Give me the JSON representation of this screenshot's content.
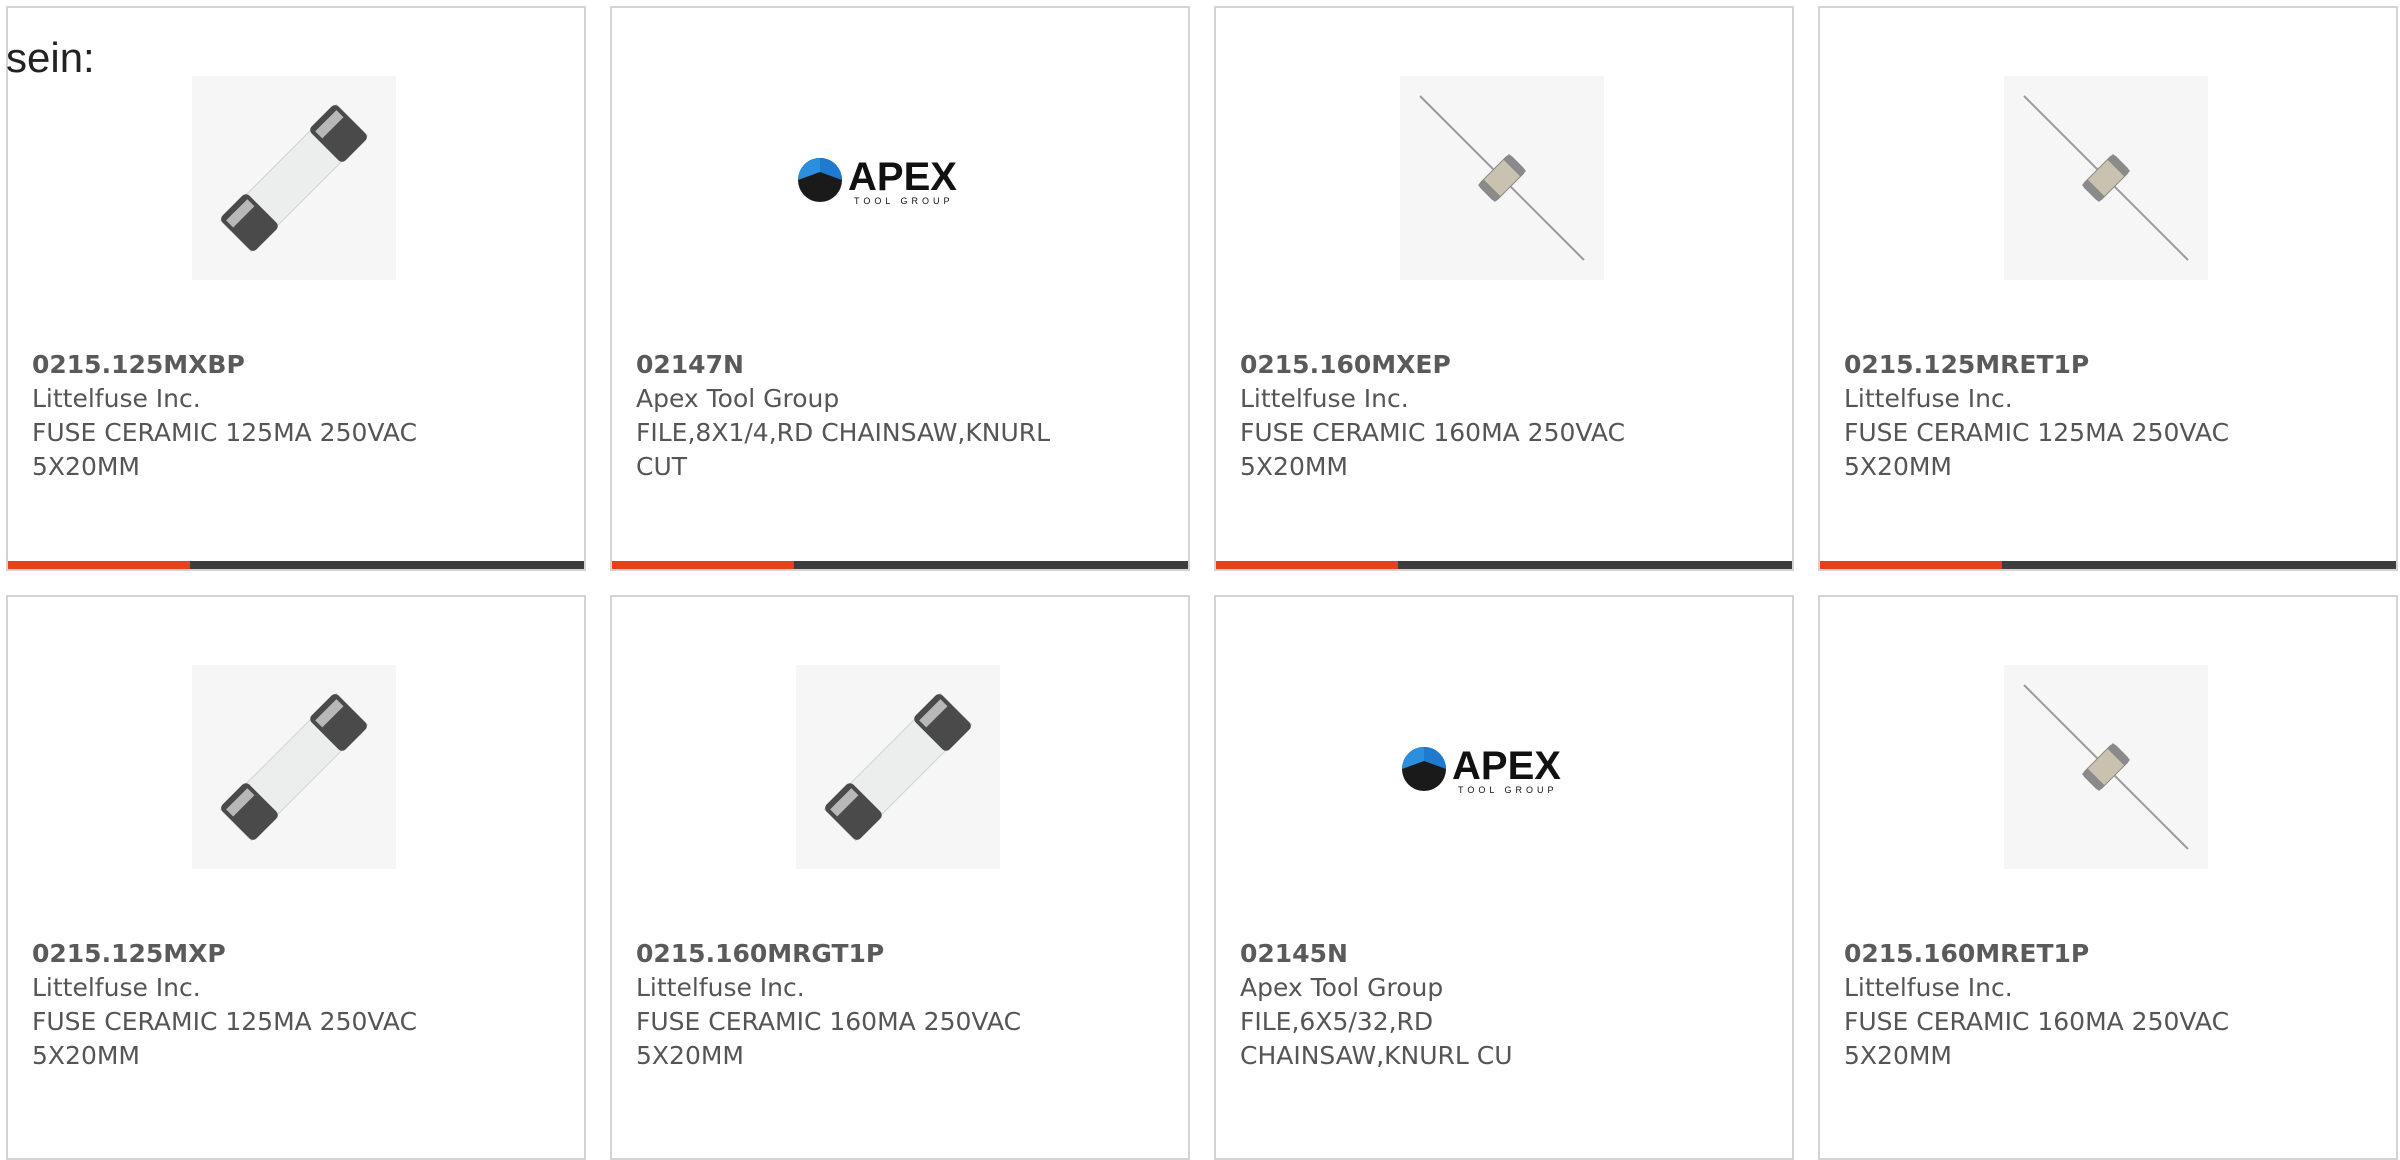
{
  "prefix_text": "sein:",
  "accent_color": "#e8401c",
  "cards": [
    {
      "part": "0215.125MXBP",
      "mfr": "Littelfuse Inc.",
      "desc1": "FUSE CERAMIC 125MA 250VAC",
      "desc2": "5X20MM",
      "image": "cartridge-fuse"
    },
    {
      "part": "02147N",
      "mfr": "Apex Tool Group",
      "desc1": "FILE,8X1/4,RD CHAINSAW,KNURL",
      "desc2": "CUT",
      "image": "apex-logo",
      "logo_text": "APEX",
      "logo_sub": "TOOL GROUP"
    },
    {
      "part": "0215.160MXEP",
      "mfr": "Littelfuse Inc.",
      "desc1": "FUSE CERAMIC 160MA 250VAC",
      "desc2": "5X20MM",
      "image": "axial-fuse"
    },
    {
      "part": "0215.125MRET1P",
      "mfr": "Littelfuse Inc.",
      "desc1": "FUSE CERAMIC 125MA 250VAC",
      "desc2": "5X20MM",
      "image": "axial-fuse"
    },
    {
      "part": "0215.125MXP",
      "mfr": "Littelfuse Inc.",
      "desc1": "FUSE CERAMIC 125MA 250VAC",
      "desc2": "5X20MM",
      "image": "cartridge-fuse"
    },
    {
      "part": "0215.160MRGT1P",
      "mfr": "Littelfuse Inc.",
      "desc1": "FUSE CERAMIC 160MA 250VAC",
      "desc2": "5X20MM",
      "image": "cartridge-fuse"
    },
    {
      "part": "02145N",
      "mfr": "Apex Tool Group",
      "desc1": "FILE,6X5/32,RD",
      "desc2": "CHAINSAW,KNURL CU",
      "image": "apex-logo",
      "logo_text": "APEX",
      "logo_sub": "TOOL GROUP"
    },
    {
      "part": "0215.160MRET1P",
      "mfr": "Littelfuse Inc.",
      "desc1": "FUSE CERAMIC 160MA 250VAC",
      "desc2": "5X20MM",
      "image": "axial-fuse"
    }
  ]
}
